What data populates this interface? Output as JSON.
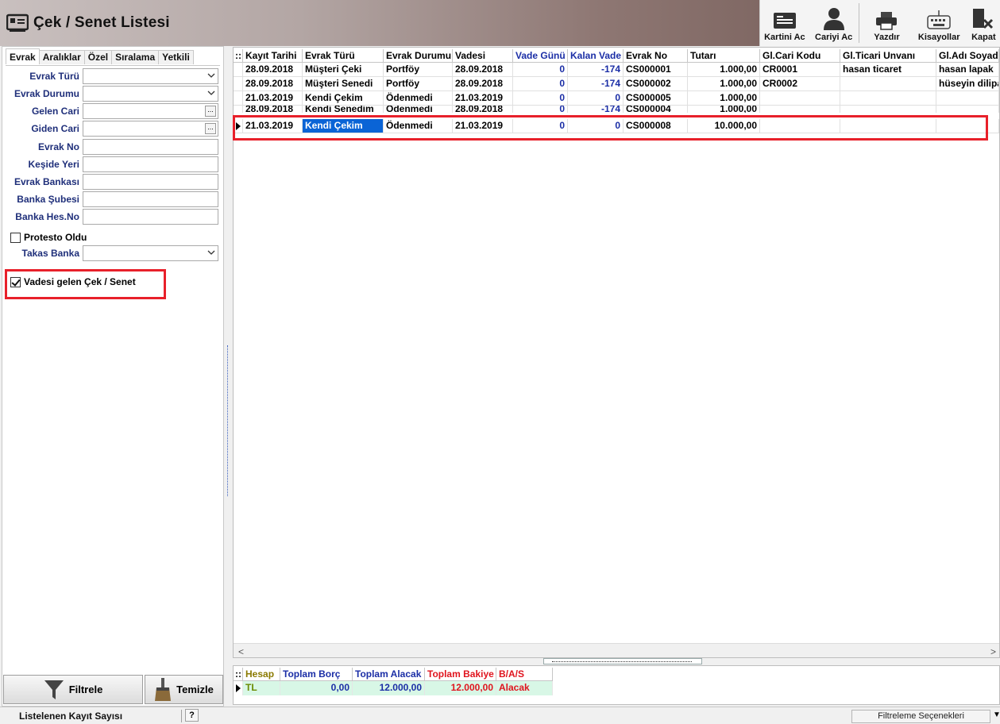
{
  "window": {
    "title": "Çek / Senet Listesi"
  },
  "toolbar": {
    "buttons": [
      {
        "label": "Kartini Ac",
        "icon": "card-icon"
      },
      {
        "label": "Cariyi Ac",
        "icon": "user-icon"
      },
      {
        "label": "Yazdır",
        "icon": "printer-icon"
      },
      {
        "label": "Kisayollar",
        "icon": "keyboard-icon"
      },
      {
        "label": "Kapat",
        "icon": "close-app-icon"
      }
    ]
  },
  "filter_panel": {
    "tabs": [
      "Evrak",
      "Aralıklar",
      "Özel",
      "Sıralama",
      "Yetkili"
    ],
    "active_tab": "Evrak",
    "fields": [
      {
        "label": "Evrak Türü",
        "type": "dropdown",
        "value": ""
      },
      {
        "label": "Evrak Durumu",
        "type": "dropdown",
        "value": ""
      },
      {
        "label": "Gelen Cari",
        "type": "lookup",
        "value": ""
      },
      {
        "label": "Giden Cari",
        "type": "lookup",
        "value": ""
      },
      {
        "label": "Evrak No",
        "type": "text",
        "value": ""
      },
      {
        "label": "Keşide Yeri",
        "type": "text",
        "value": ""
      },
      {
        "label": "Evrak Bankası",
        "type": "text",
        "value": ""
      },
      {
        "label": "Banka Şubesi",
        "type": "text",
        "value": ""
      },
      {
        "label": "Banka Hes.No",
        "type": "text",
        "value": ""
      }
    ],
    "protesto_label": "Protesto Oldu",
    "protesto_checked": false,
    "takas_label": "Takas Banka",
    "takas_value": "",
    "vadesi_label": "Vadesi gelen Çek / Senet",
    "vadesi_checked": true,
    "filter_button": "Filtrele",
    "clear_button": "Temizle"
  },
  "grid": {
    "columns": [
      "Kayıt Tarihi",
      "Evrak Türü",
      "Evrak Durumu",
      "Vadesi",
      "Vade Günü",
      "Kalan Vade",
      "Evrak No",
      "Tutarı",
      "Gl.Cari Kodu",
      "Gl.Ticari Unvanı",
      "Gl.Adı Soyadı"
    ],
    "rows": [
      [
        "28.09.2018",
        "Müşteri Çeki",
        "Portföy",
        "28.09.2018",
        "0",
        "-174",
        "CS000001",
        "1.000,00",
        "CR0001",
        "hasan ticaret",
        "hasan lapak"
      ],
      [
        "28.09.2018",
        "Müşteri Senedi",
        "Portföy",
        "28.09.2018",
        "0",
        "-174",
        "CS000002",
        "1.000,00",
        "CR0002",
        "",
        "hüseyin dilipak"
      ],
      [
        "21.03.2019",
        "Kendi Çekim",
        "Ödenmedi",
        "21.03.2019",
        "0",
        "0",
        "CS000005",
        "1.000,00",
        "",
        "",
        ""
      ],
      [
        "28.09.2018",
        "Kendi Senedim",
        "Ödenmedi",
        "28.09.2018",
        "0",
        "-174",
        "CS000004",
        "1.000,00",
        "",
        "",
        ""
      ],
      [
        "21.03.2019",
        "Kendi Çekim",
        "Ödenmedi",
        "21.03.2019",
        "0",
        "0",
        "CS000008",
        "10.000,00",
        "",
        "",
        ""
      ]
    ]
  },
  "summary": {
    "columns": [
      "Hesap",
      "Toplam Borç",
      "Toplam Alacak",
      "Toplam Bakiye",
      "B/A/S"
    ],
    "row": [
      "TL",
      "0,00",
      "12.000,00",
      "12.000,00",
      "Alacak"
    ],
    "colors": {
      "hesap": "#8a7a00",
      "borc": "#1b2ea6",
      "alacak": "#1b2ea6",
      "bakiye": "#e0141e",
      "bas": "#e0141e",
      "tl": "#6a8a00"
    }
  },
  "statusbar": {
    "count_label": "Listelenen Kayıt Sayısı",
    "help": "?",
    "filter_options": "Filtreleme Seçenekleri"
  },
  "colors": {
    "highlight_box": "#e8202a",
    "selection": "#0a64d6",
    "label_blue": "#1f2f7a"
  }
}
